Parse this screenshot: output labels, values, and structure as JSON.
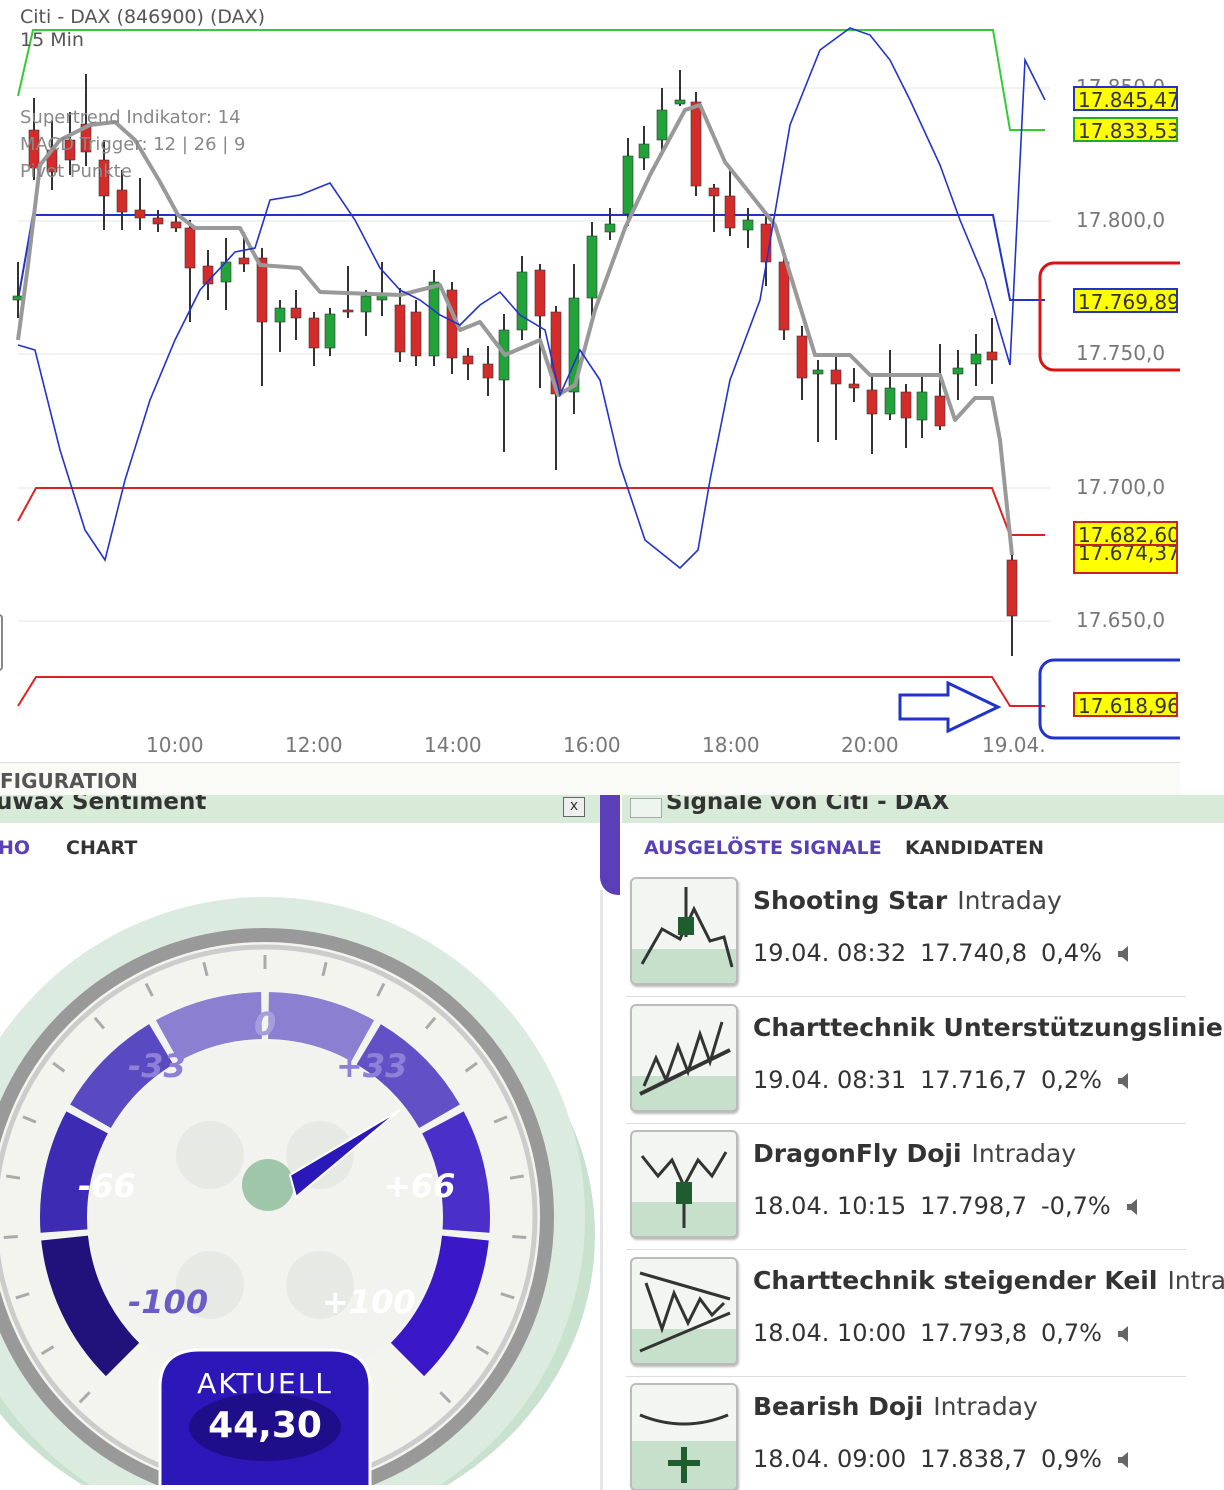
{
  "chart": {
    "title": "Citi - DAX (846900) (DAX)",
    "timeframe": "15 Min",
    "indicators": [
      "Supertrend Indikator: 14",
      "MACD Trigger: 12 | 26 | 9",
      "Pivot Punkte"
    ],
    "y_ticks": [
      "17.850,0",
      "17.800,0",
      "17.750,0",
      "17.700,0",
      "17.650,0"
    ],
    "x_ticks": [
      "10:00",
      "12:00",
      "14:00",
      "16:00",
      "18:00",
      "20:00",
      "19.04."
    ],
    "price_labels": [
      {
        "value": "17.845,47",
        "color": "#ffff00",
        "border": "#2233cc"
      },
      {
        "value": "17.833,53",
        "color": "#ffff00",
        "border": "#22aa22"
      },
      {
        "value": "17.769,89",
        "color": "#ffff00",
        "border": "#2233cc"
      },
      {
        "value": "17.682,60",
        "color": "#ffff00",
        "border": "#cc2222"
      },
      {
        "value": "17.674,37",
        "color": "#ffff00",
        "border": "#cc2222"
      },
      {
        "value": "17.618,96",
        "color": "#ffff00",
        "border": "#cc2222"
      }
    ],
    "colors": {
      "bull": "#22a33a",
      "bear": "#d42b2b",
      "supertrend": "#999999",
      "macd": "#2233cc",
      "pivot_r": "#33cc33",
      "pivot_s": "#dd2222",
      "annotation_red": "#dd1111",
      "annotation_blue": "#2233cc"
    }
  },
  "configuration_label": "FIGURATION",
  "sentiment": {
    "title": "uwax Sentiment",
    "close_label": "x",
    "tabs": [
      "HO",
      "CHART"
    ],
    "gauge_labels": [
      "-100",
      "-66",
      "-33",
      "0",
      "+33",
      "+66",
      "+100"
    ],
    "current_label": "AKTUELL",
    "current_value": "44,30",
    "current_numeric": 44.3
  },
  "signals": {
    "title": "Signale von Citi - DAX",
    "tabs": [
      "AUSGELÖSTE SIGNALE",
      "KANDIDATEN"
    ],
    "items": [
      {
        "name": "Shooting Star",
        "type": "Intraday",
        "date": "19.04. 08:32",
        "price": "17.740,8",
        "change": "0,4%",
        "icon": "shooting-star-icon"
      },
      {
        "name": "Charttechnik Unterstützungslinie",
        "type": "",
        "date": "19.04. 08:31",
        "price": "17.716,7",
        "change": "0,2%",
        "icon": "support-line-icon"
      },
      {
        "name": "DragonFly Doji",
        "type": "Intraday",
        "date": "18.04. 10:15",
        "price": "17.798,7",
        "change": "-0,7%",
        "icon": "dragonfly-doji-icon"
      },
      {
        "name": "Charttechnik steigender Keil",
        "type": "Intra",
        "date": "18.04. 10:00",
        "price": "17.793,8",
        "change": "0,7%",
        "icon": "rising-wedge-icon"
      },
      {
        "name": "Bearish Doji",
        "type": "Intraday",
        "date": "18.04. 09:00",
        "price": "17.838,7",
        "change": "0,9%",
        "icon": "bearish-doji-icon"
      }
    ]
  }
}
